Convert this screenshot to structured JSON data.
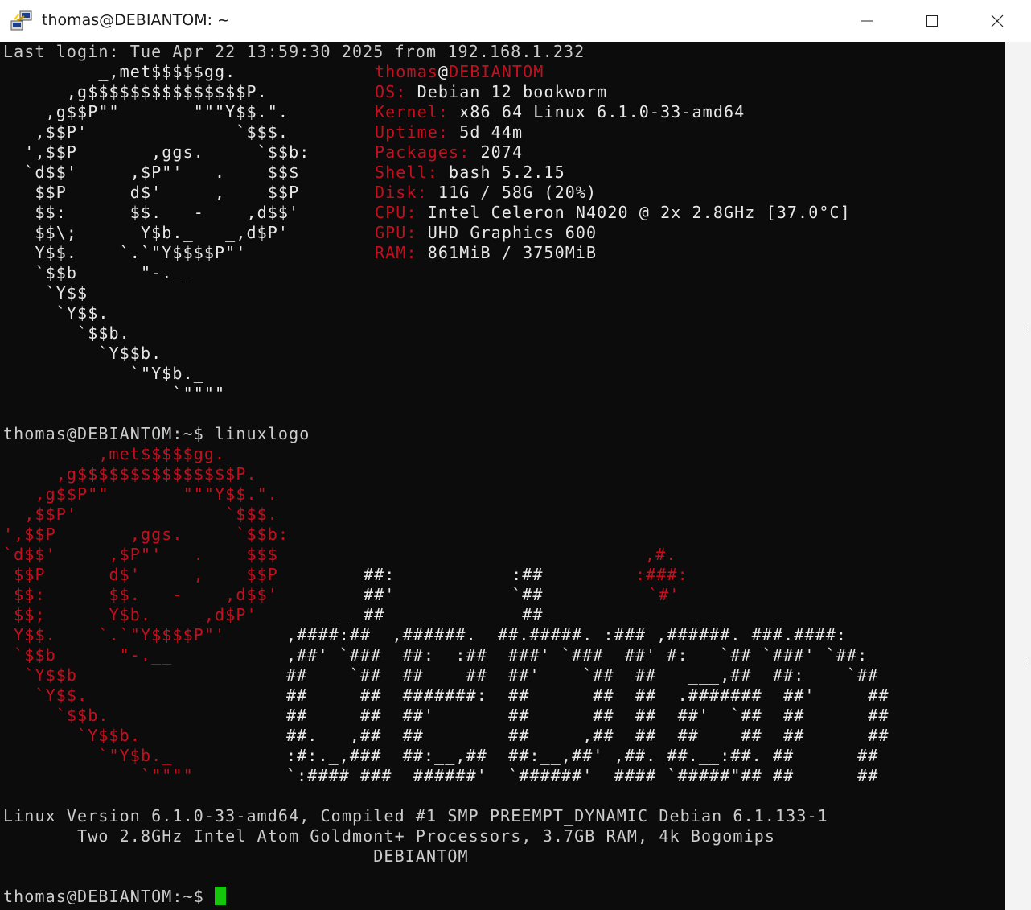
{
  "window": {
    "title": "thomas@DEBIANTOM: ~",
    "minimize_icon": "minimize-icon",
    "maximize_icon": "maximize-icon",
    "close_icon": "close-icon",
    "app_icon": "putty-terminal-icon"
  },
  "colors": {
    "terminal_bg": "#0c0c0c",
    "text": "#cccccc",
    "accent_red": "#c50f1f",
    "cursor": "#16c60c"
  },
  "terminal": {
    "last_login": "Last login: Tue Apr 22 13:59:30 2025 from 192.168.1.232",
    "neofetch_logo": [
      "         _,met$$$$$gg.",
      "      ,g$$$$$$$$$$$$$$$P.",
      "    ,g$$P\"\"       \"\"\"Y$$.\".",
      "   ,$$P'              `$$$.",
      "  ',$$P       ,ggs.     `$$b:",
      "  `d$$'     ,$P\"'   .    $$$",
      "   $$P      d$'     ,    $$P",
      "   $$:      $$.   -    ,d$$'",
      "   $$\\;      Y$b._   _,d$P'",
      "   Y$$.    `.`\"Y$$$$P\"'",
      "   `$$b      \"-.__",
      "    `Y$$",
      "     `Y$$.",
      "       `$$b.",
      "         `Y$$b.",
      "            `\"Y$b._",
      "                `\"\"\"\""
    ],
    "user": "thomas",
    "at": "@",
    "host": "DEBIANTOM",
    "sysinfo": [
      {
        "key": "OS:",
        "value": " Debian 12 bookworm"
      },
      {
        "key": "Kernel:",
        "value": " x86_64 Linux 6.1.0-33-amd64"
      },
      {
        "key": "Uptime:",
        "value": " 5d 44m"
      },
      {
        "key": "Packages:",
        "value": " 2074"
      },
      {
        "key": "Shell:",
        "value": " bash 5.2.15"
      },
      {
        "key": "Disk:",
        "value": " 11G / 58G (20%)"
      },
      {
        "key": "CPU:",
        "value": " Intel Celeron N4020 @ 2x 2.8GHz [37.0°C]"
      },
      {
        "key": "GPU:",
        "value": " UHD Graphics 600"
      },
      {
        "key": "RAM:",
        "value": " 861MiB / 3750MiB"
      }
    ],
    "command_line": "thomas@DEBIANTOM:~$ linuxlogo",
    "linuxlogo_swirl": [
      "        _,met$$$$$gg.",
      "     ,g$$$$$$$$$$$$$$$P.",
      "   ,g$$P\"\"       \"\"\"Y$$.\".",
      "  ,$$P'              `$$$.",
      "',$$P       ,ggs.     `$$b:",
      "`d$$'     ,$P\"'   .    $$$",
      " $$P      d$'     ,    $$P",
      " $$:      $$.   -    ,d$$'",
      " $$;      Y$b._   _,d$P'",
      " Y$$.    `.`\"Y$$$$P\"'",
      " `$$b      \"-.__",
      "  `Y$$b",
      "   `Y$$.",
      "     `$$b.",
      "       `Y$$b.",
      "         `\"Y$b._",
      "             `\"\"\"\""
    ],
    "debian_mark": [
      ",#.",
      ":###:",
      "`#'"
    ],
    "debian_word": [
      "##:           :##",
      "##'           `##",
      "##             ##",
      ",####:##  ,######.  ##.#####. :### ,######. ###.####:",
      ",##' `###  ##:  :##  ###' `###  ##' #:   `## `###' `##:",
      "##    `##  ##    ##  ##'    `##  ##   ___,##  ##:    `##",
      "##     ##  #######:  ##      ##  ##  .#######  ##'     ##",
      "##     ##  ##'       ##      ##  ##  ##'  `##  ##      ##",
      "##.   ,##  ##        ##     ,##  ##  ##    ##  ##      ##",
      ":#:._,###  ##:__,##  ##:__,##' ,##. ##.__:##. ##      ##",
      "`:#### ###  ######'  `######'  #### `#####\"## ##      ##"
    ],
    "underscores_row": "___       ___       ___       _    ___     _",
    "version_line": "Linux Version 6.1.0-33-amd64, Compiled #1 SMP PREEMPT_DYNAMIC Debian 6.1.133-1",
    "cpu_line": "       Two 2.8GHz Intel Atom Goldmont+ Processors, 3.7GB RAM, 4k Bogomips",
    "hostname_line": "                                   DEBIANTOM",
    "final_prompt": "thomas@DEBIANTOM:~$ "
  }
}
